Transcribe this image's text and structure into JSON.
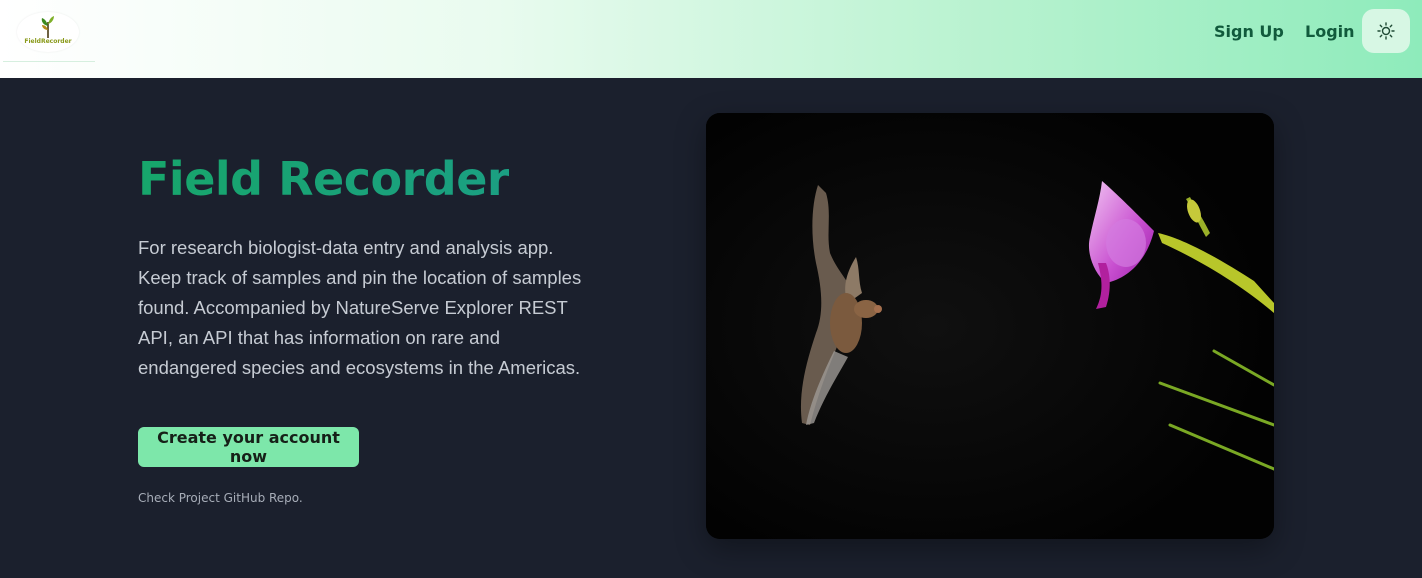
{
  "header": {
    "logo_text": "FieldRecorder",
    "signup_label": "Sign Up",
    "login_label": "Login",
    "theme_icon": "sun-icon"
  },
  "hero": {
    "title": "Field Recorder",
    "description": "For research biologist-data entry and analysis app. Keep track of samples and pin the location of samples found. Accompanied by NatureServe Explorer REST API, an API that has information on rare and endangered species and ecosystems in the Americas.",
    "cta_label": "Create your account now",
    "repo_link": "Check Project GitHub Repo."
  },
  "photo": {
    "subject": "bat-and-orchid-photo"
  },
  "colors": {
    "background": "#1b202d",
    "accent": "#7de7aa",
    "title_gradient_start": "#17a66b",
    "title_gradient_end": "#1b9f82",
    "nav_text": "#115a3c"
  }
}
